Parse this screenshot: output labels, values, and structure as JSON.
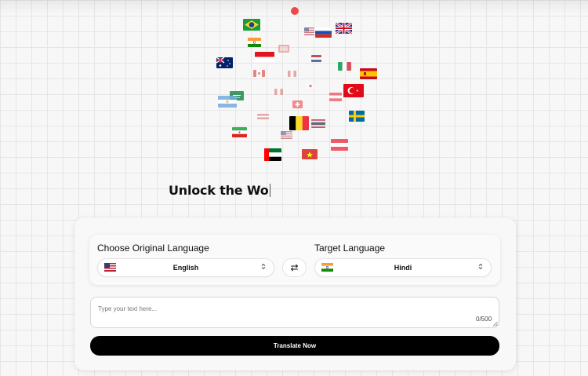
{
  "hero": {
    "typed_text": "Unlock the Wo"
  },
  "flags": [
    "brazil-flag",
    "usa-flag",
    "uk-flag",
    "russia-flag",
    "india-flag",
    "indonesia-flag",
    "australia-flag",
    "italy-flag",
    "spain-flag",
    "canada-flag",
    "argentina-flag",
    "turkey-flag",
    "saudi-flag",
    "belgium-flag",
    "sweden-flag",
    "iran-flag",
    "uae-flag",
    "vietnam-flag",
    "thailand-flag",
    "austria-flag",
    "japan-flag",
    "switzerland-flag",
    "netherlands-flag"
  ],
  "translator": {
    "source_label": "Choose Original Language",
    "target_label": "Target Language",
    "source_value": "English",
    "target_value": "Hindi",
    "source_flag": "usa-flag",
    "target_flag": "india-flag",
    "swap_icon": "⇄",
    "textarea_placeholder": "Type your text here...",
    "char_count": "0/500",
    "translate_label": "Translate Now"
  },
  "colors": {
    "button_bg": "#000000",
    "accent_dot": "#ef4848"
  }
}
